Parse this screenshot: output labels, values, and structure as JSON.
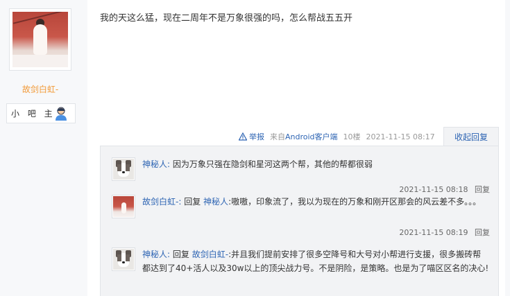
{
  "user": {
    "name": "故剑白虹-",
    "role": "小 吧 主"
  },
  "post": {
    "text": "我的天这么猛，现在二周年不是万象很强的吗，怎么帮战五五开",
    "report": "举报",
    "client_prefix": "来自",
    "client_name": "Android客户端",
    "floor": "10楼",
    "time": "2021-11-15 08:17",
    "collapse_label": "收起回复"
  },
  "replies": [
    {
      "author": "神秘人:",
      "reply_to": "",
      "text": "因为万象只强在隐剑和星河这两个帮，其他的帮都很弱",
      "time": "2021-11-15 08:18",
      "reply_label": "回复"
    },
    {
      "author": "故剑白虹-:",
      "reply_word": "回复",
      "reply_to": "神秘人",
      "text": ":嗷嗷，印象流了，我以为现在的万象和刚开区那会的风云差不多。。。",
      "time": "2021-11-15 08:19",
      "reply_label": "回复"
    },
    {
      "author": "神秘人:",
      "reply_word": "回复",
      "reply_to": "故剑白虹-",
      "text": ":并且我们提前安排了很多空降号和大号对小帮进行支援，很多搬砖帮都达到了40+活人以及30w以上的顶尖战力号。不是阴险，是策略。也是为了喵区区名的决心!"
    }
  ]
}
